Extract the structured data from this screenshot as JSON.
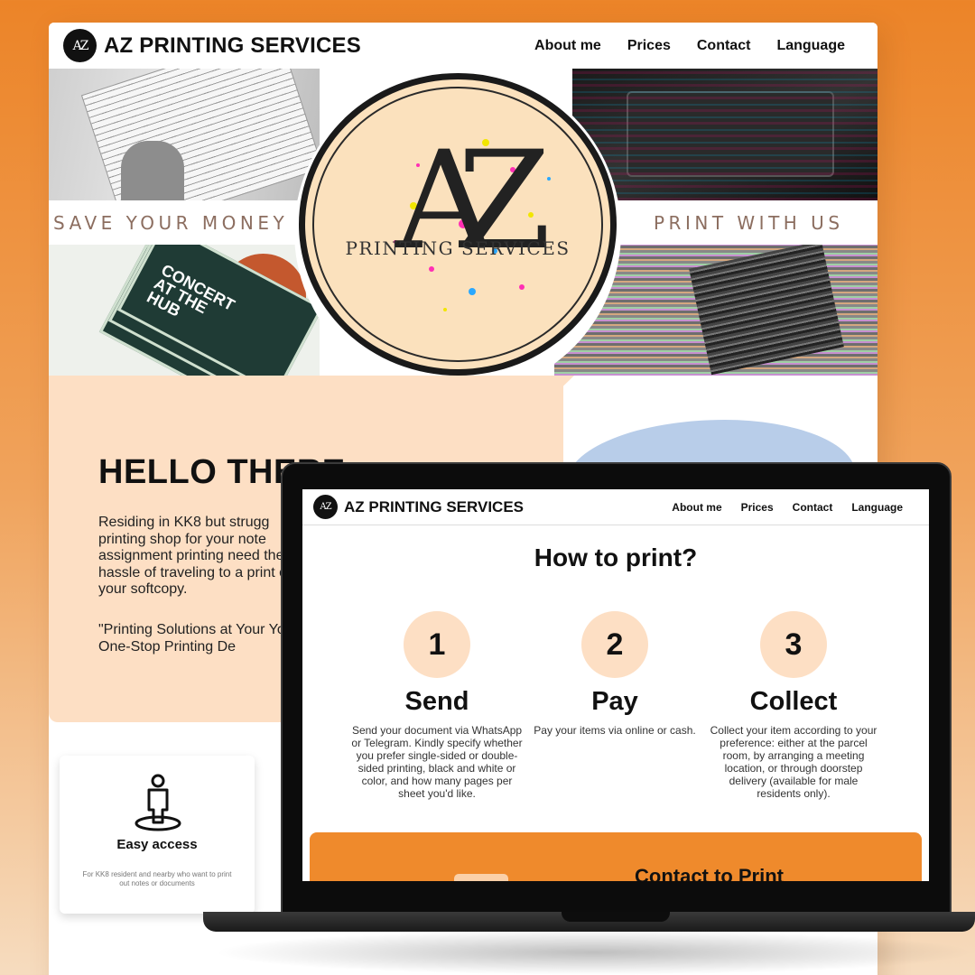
{
  "site": {
    "brand": "AZ PRINTING SERVICES",
    "logo_letters": "AZ",
    "nav": [
      "About me",
      "Prices",
      "Contact",
      "Language"
    ]
  },
  "hero": {
    "tag_left": "SAVE YOUR MONEY",
    "tag_right": "PRINT WITH US",
    "seal_letters": "AZ",
    "seal_sub": "PRINTING SERVICES",
    "flyer_text": "CONCERT AT THE HUB"
  },
  "hello": {
    "title": "HELLO THERE",
    "body": "Residing in KK8 but strugg printing shop for your note assignment printing need the hassle of traveling to a print out your softcopy.",
    "quote": "\"Printing Solutions at Your Your One-Stop Printing De"
  },
  "feature": {
    "title": "Easy access",
    "text": "For KK8 resident and nearby who want to print out notes or documents",
    "icon": "person-pin-icon"
  },
  "laptop_screen": {
    "brand": "AZ PRINTING SERVICES",
    "nav": [
      "About me",
      "Prices",
      "Contact",
      "Language"
    ],
    "heading": "How to print?",
    "steps": [
      {
        "num": "1",
        "title": "Send",
        "desc": "Send your document via WhatsApp or Telegram. Kindly specify whether you prefer single-sided or double-sided printing, black and white or color, and how many pages per sheet you'd like."
      },
      {
        "num": "2",
        "title": "Pay",
        "desc": "Pay your items via online or cash."
      },
      {
        "num": "3",
        "title": "Collect",
        "desc": "Collect your item according to your preference: either at the parcel room, by arranging a meeting location, or through doorstep delivery (available for male residents only)."
      }
    ],
    "cta": "Contact to Print"
  },
  "colors": {
    "background_orange": "#ec8428",
    "peach": "#fddfc4",
    "cta_orange": "#ef8a2c",
    "blob_blue": "#b8cde9"
  }
}
